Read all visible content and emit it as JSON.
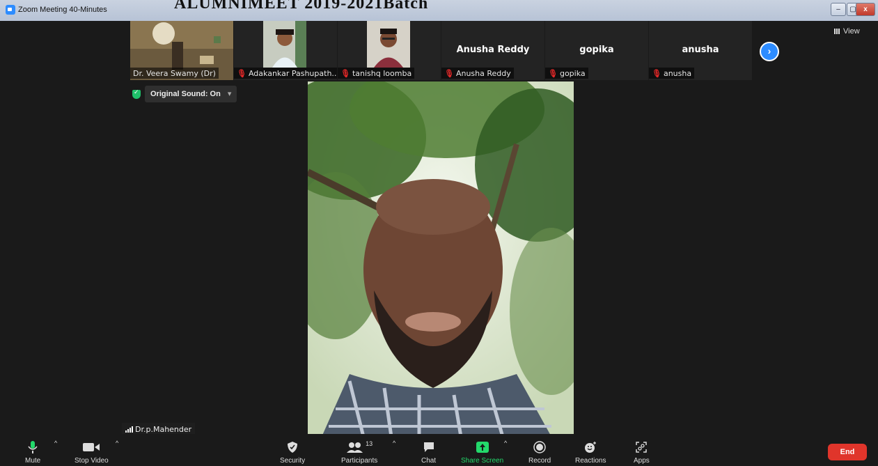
{
  "window": {
    "banner": "ALUMNIMEET 2019-2021Batch",
    "title": "Zoom Meeting 40-Minutes",
    "controls": [
      "–",
      "▢",
      "x"
    ]
  },
  "participants_strip": [
    {
      "name": "Dr. Veera Swamy (Dr)",
      "muted": false,
      "has_video": true
    },
    {
      "name": "Adakankar Pashupath...",
      "muted": true,
      "has_video": true
    },
    {
      "name": "tanishq loomba",
      "muted": true,
      "has_video": true
    },
    {
      "name": "Anusha Reddy",
      "display_name": "Anusha Reddy",
      "muted": true,
      "has_video": false
    },
    {
      "name": "gopika",
      "display_name": "gopika",
      "muted": true,
      "has_video": false
    },
    {
      "name": "anusha",
      "display_name": "anusha",
      "muted": true,
      "has_video": false
    }
  ],
  "view_button": "View",
  "original_sound": "Original Sound: On",
  "speaker_name": "Dr.p.Mahender",
  "toolbar": {
    "mute": "Mute",
    "stop_video": "Stop Video",
    "security": "Security",
    "participants": "Participants",
    "participants_count": "13",
    "chat": "Chat",
    "share_screen": "Share Screen",
    "record": "Record",
    "reactions": "Reactions",
    "apps": "Apps",
    "end": "End"
  },
  "colors": {
    "background": "#1a1a1a",
    "accent_blue": "#2d8cff",
    "share_green": "#23d96b",
    "end_red": "#e0352b",
    "muted_red": "#e02828"
  }
}
